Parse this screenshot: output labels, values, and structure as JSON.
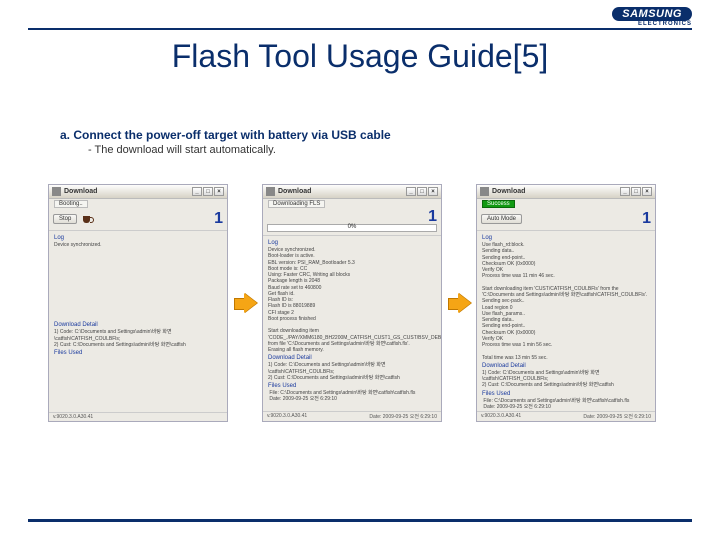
{
  "logo": {
    "main": "SAMSUNG",
    "sub": "ELECTRONICS"
  },
  "title": "Flash Tool Usage Guide[5]",
  "step": {
    "label": "a. Connect the power-off target with battery via USB cable",
    "sub": "- The download will start automatically."
  },
  "win_common": {
    "title": "Download",
    "channel": "1",
    "version": "v.9020.3.0.A30.41",
    "date2": "Date: 2009-09-25 오전 6:29:10"
  },
  "w1": {
    "status": "Booting..",
    "stop": "Stop",
    "log_label": "Log",
    "log": "Device synchronized.",
    "dd_label": "Download Detail",
    "dd": "1) Code: C:\\Documents and Settings\\admin\\바탕 화면\\catfish\\CATFISH_COULBFls;\n2) Cust: C:\\Documents and Settings\\admin\\바탕 화면\\catfish",
    "fu_label": "Files Used"
  },
  "w2": {
    "status": "Downloading FLS",
    "plabel": "0%",
    "log_label": "Log",
    "log": "Device synchronized.\nBoot-loader is active.\nEBL version: PSI_RAM_Bootloader 5.3\nBoot mode is: CC\nUsing: Faster CRC, Writing all blocks\nPackage length is 2048\nBaud rate set to 460800\nGet flash id.\nFlash ID is:\nFlash ID is 88019889\nCFI stage 2\nBoot process finished\n\nStart downloading item 'CODE_./PAY/XMM6180_BH2200M_CATFISH_CUST1_GS_CUST/BSV_DEBUG/catfish.fls' from file 'C:\\Documents and Settings\\admin\\바탕 화면\\catfish.fls'.\nErasing all flash memory.",
    "dd_label": "Download Detail",
    "dd": "1) Code: C:\\Documents and Settings\\admin\\바탕 화면\\catfish\\CATFISH_COULBFls;\n2) Cust: C:\\Documents and Settings\\admin\\바탕 화면\\catfish",
    "fu_label": "Files Used",
    "fu": " File: C:\\Documents and Settings\\admin\\바탕 화면\\catfish\\catfish.fls\n Date: 2009-09-25 오전 6:29:10"
  },
  "w3": {
    "status": "Success",
    "mode": "Auto Mode",
    "log_label": "Log",
    "log": "Use flash_rd:block.\nSending data..\nSending end-point..\nChecksum OK (0x0000)\nVerify OK\nProcess time was 11 min 46 sec.\n\nStart downloading item 'CUST/CATFISH_COULBFls' from the 'C:\\Documents and Settings\\admin\\바탕 화면\\catfish\\CATFISH_COULBFls'.\nSending sec-pack..\nLoad region 0\nUse flash_params..\nSending data..\nSending end-point..\nChecksum OK (0x0000)\nVerify OK\nProcess time was 1 min 56 sec.\n\nTotal time was 13 min 55 sec.",
    "dd_label": "Download Detail",
    "dd": "1) Code: C:\\Documents and Settings\\admin\\바탕 화면\\catfish\\CATFISH_COULBFls;\n2) Cust: C:\\Documents and Settings\\admin\\바탕 화면\\catfish",
    "fu_label": "Files Used",
    "fu": " File: C:\\Documents and Settings\\admin\\바탕 화면\\catfish\\catfish.fls\n Date: 2009-09-25 오전 6:29:10"
  }
}
